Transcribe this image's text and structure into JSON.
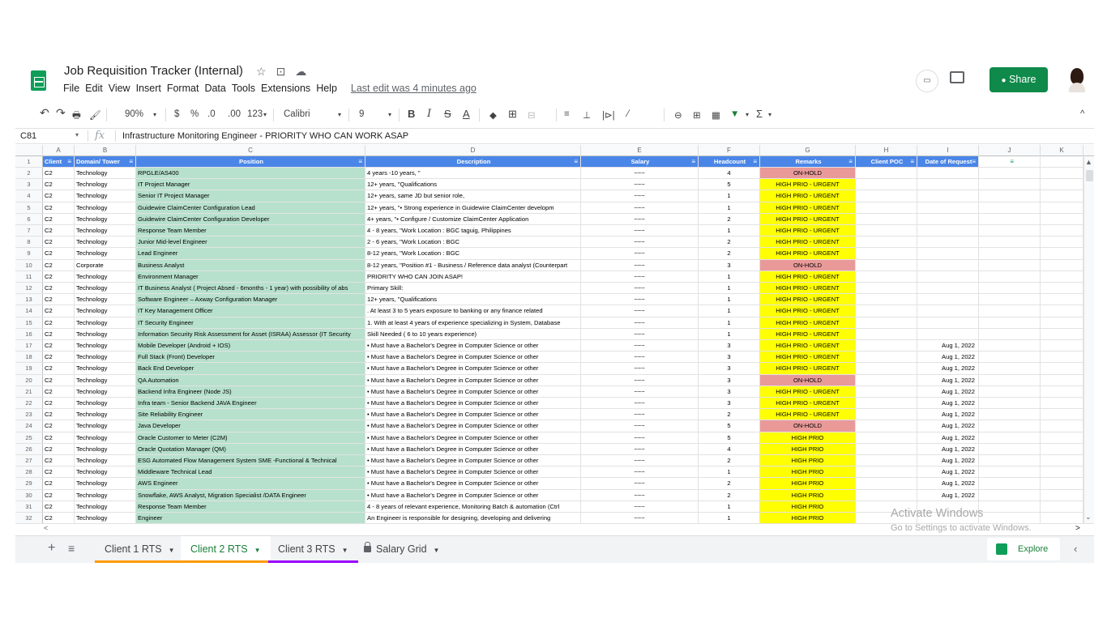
{
  "doc": {
    "title": "Job Requisition Tracker (Internal)",
    "star_icon": "☆",
    "move_icon": "⊡",
    "cloud_icon": "☁",
    "last_edit": "Last edit was 4 minutes ago",
    "share_label": "Share",
    "share_icon": "👤"
  },
  "menu": [
    "File",
    "Edit",
    "View",
    "Insert",
    "Format",
    "Data",
    "Tools",
    "Extensions",
    "Help"
  ],
  "toolbar": {
    "undo": "↶",
    "redo": "↷",
    "print": "🖶",
    "paint": "🖌",
    "zoom": "90%",
    "dropdown": "▾",
    "currency": "$",
    "percent": "%",
    "dec_less": ".0",
    "dec_more": ".00",
    "more_formats": "123",
    "font": "Calibri",
    "size": "9",
    "bold": "B",
    "italic": "I",
    "strike": "S",
    "textcolor": "A",
    "fill": "◆",
    "borders": "⊞",
    "merge": "⊟",
    "halign": "≡",
    "valign": "⊥",
    "wrap": "|⊳|",
    "rotate": "⁄",
    "link": "⊖",
    "comment": "⊞",
    "chart": "▦",
    "filter": "▼",
    "functions": "Σ",
    "collapse": "^"
  },
  "formula": {
    "cell_ref": "C81",
    "fx": "fx",
    "content": "Infrastructure Monitoring Engineer  - PRIORITY WHO CAN WORK ASAP"
  },
  "columns": [
    "A",
    "B",
    "C",
    "D",
    "E",
    "F",
    "G",
    "H",
    "I",
    "J",
    "K"
  ],
  "header": {
    "client": "Client",
    "domain": "Domain/ Tower",
    "position": "Position",
    "description": "Description",
    "salary": "Salary",
    "headcount": "Headcount",
    "remarks": "Remarks",
    "client_poc": "Client POC",
    "date": "Date of Request",
    "filter_icon": "≡"
  },
  "rows": [
    {
      "n": "2",
      "client": "C2",
      "domain": "Technology",
      "position": "RPGLE/AS400",
      "description": "4 years -10 years, \"",
      "salary": "~~~",
      "headcount": "4",
      "remarks": "ON-HOLD",
      "status": "hold",
      "date": ""
    },
    {
      "n": "3",
      "client": "C2",
      "domain": "Technology",
      "position": "IT Project Manager",
      "description": "12+ years, \"Qualifications",
      "salary": "~~~",
      "headcount": "5",
      "remarks": "HIGH PRIO - URGENT",
      "status": "urgent",
      "date": ""
    },
    {
      "n": "4",
      "client": "C2",
      "domain": "Technology",
      "position": "Senior IT Project Manager",
      "description": "12+ years, same JD but senior role,",
      "salary": "~~~",
      "headcount": "1",
      "remarks": "HIGH PRIO - URGENT",
      "status": "urgent",
      "date": ""
    },
    {
      "n": "5",
      "client": "C2",
      "domain": "Technology",
      "position": "Guidewire ClaimCenter Configuration Lead",
      "description": "12+ years, \"•       Strong experience in Guidewire ClaimCenter developm",
      "salary": "~~~",
      "headcount": "1",
      "remarks": "HIGH PRIO - URGENT",
      "status": "urgent",
      "date": ""
    },
    {
      "n": "6",
      "client": "C2",
      "domain": "Technology",
      "position": "Guidewire ClaimCenter Configuration Developer",
      "description": "4+ years, \"•       Configure / Customize ClaimCenter Application",
      "salary": "~~~",
      "headcount": "2",
      "remarks": "HIGH PRIO - URGENT",
      "status": "urgent",
      "date": ""
    },
    {
      "n": "7",
      "client": "C2",
      "domain": "Technology",
      "position": "Response Team Member",
      "description": "4 - 8 years, \"Work Location :  BGC taguig, Philippines",
      "salary": "~~~",
      "headcount": "1",
      "remarks": "HIGH PRIO - URGENT",
      "status": "urgent",
      "date": ""
    },
    {
      "n": "8",
      "client": "C2",
      "domain": "Technology",
      "position": "Junior Mid-level Engineer",
      "description": "2 - 6 years, \"Work Location : BGC",
      "salary": "~~~",
      "headcount": "2",
      "remarks": "HIGH PRIO - URGENT",
      "status": "urgent",
      "date": ""
    },
    {
      "n": "9",
      "client": "C2",
      "domain": "Technology",
      "position": "Lead Engineer",
      "description": "8-12 years, \"Work Location : BGC",
      "salary": "~~~",
      "headcount": "2",
      "remarks": "HIGH PRIO - URGENT",
      "status": "urgent",
      "date": ""
    },
    {
      "n": "10",
      "client": "C2",
      "domain": "Corporate",
      "position": "Business Analyst",
      "description": "8-12 years, \"Position #1 - Business / Reference data analyst (Counterpart",
      "salary": "~~~",
      "headcount": "3",
      "remarks": "ON-HOLD",
      "status": "hold",
      "date": ""
    },
    {
      "n": "11",
      "client": "C2",
      "domain": "Technology",
      "position": "Environment Manager",
      "description": "PRIORITY WHO CAN JOIN ASAP!",
      "salary": "~~~",
      "headcount": "1",
      "remarks": "HIGH PRIO - URGENT",
      "status": "urgent",
      "date": ""
    },
    {
      "n": "12",
      "client": "C2",
      "domain": "Technology",
      "position": "IT Business Analyst ( Project Absed - 6months - 1 year) with possibility of abs",
      "description": "Primary Skill:",
      "salary": "~~~",
      "headcount": "1",
      "remarks": "HIGH PRIO - URGENT",
      "status": "urgent",
      "date": ""
    },
    {
      "n": "13",
      "client": "C2",
      "domain": "Technology",
      "position": "Software Engineer – Axway Configuration Manager",
      "description": "12+ years, \"Qualifications",
      "salary": "~~~",
      "headcount": "1",
      "remarks": "HIGH PRIO - URGENT",
      "status": "urgent",
      "date": ""
    },
    {
      "n": "14",
      "client": "C2",
      "domain": "Technology",
      "position": "IT Key Management Officer",
      "description": ". At least 3 to 5 years exposure to banking or any finance related",
      "salary": "~~~",
      "headcount": "1",
      "remarks": "HIGH PRIO - URGENT",
      "status": "urgent",
      "date": ""
    },
    {
      "n": "15",
      "client": "C2",
      "domain": "Technology",
      "position": "IT Security Engineer",
      "description": "1. With at least 4 years of experience specializing in System, Database",
      "salary": "~~~",
      "headcount": "1",
      "remarks": "HIGH PRIO - URGENT",
      "status": "urgent",
      "date": ""
    },
    {
      "n": "16",
      "client": "C2",
      "domain": "Technology",
      "position": " Information Security Risk Assessment for Asset (ISRAA) Assessor (IT Security",
      "description": "Skill Needed ( 6 to 10 years experience)",
      "salary": "~~~",
      "headcount": "1",
      "remarks": "HIGH PRIO - URGENT",
      "status": "urgent",
      "date": ""
    },
    {
      "n": "17",
      "client": "C2",
      "domain": "Technology",
      "position": "Mobile Developer (Android + IOS)",
      "description": "•       Must have a Bachelor's Degree in Computer Science or other",
      "salary": "~~~",
      "headcount": "3",
      "remarks": "HIGH PRIO - URGENT",
      "status": "urgent",
      "date": "Aug 1, 2022"
    },
    {
      "n": "18",
      "client": "C2",
      "domain": "Technology",
      "position": "Full Stack (Front) Developer",
      "description": "•       Must have a Bachelor's Degree in Computer Science or other",
      "salary": "~~~",
      "headcount": "3",
      "remarks": "HIGH PRIO - URGENT",
      "status": "urgent",
      "date": "Aug 1, 2022"
    },
    {
      "n": "19",
      "client": "C2",
      "domain": "Technology",
      "position": "Back End Developer",
      "description": "•       Must have a Bachelor's Degree in Computer Science or other",
      "salary": "~~~",
      "headcount": "3",
      "remarks": "HIGH PRIO - URGENT",
      "status": "urgent",
      "date": "Aug 1, 2022"
    },
    {
      "n": "20",
      "client": "C2",
      "domain": "Technology",
      "position": "QA Automation",
      "description": "•       Must have a Bachelor's Degree in Computer Science or other",
      "salary": "~~~",
      "headcount": "3",
      "remarks": "ON-HOLD",
      "status": "hold",
      "date": "Aug 1, 2022"
    },
    {
      "n": "21",
      "client": "C2",
      "domain": "Technology",
      "position": "Backend Infra Engineer (Node JS)",
      "description": "•       Must have a Bachelor's Degree in Computer Science or other",
      "salary": "~~~",
      "headcount": "3",
      "remarks": "HIGH PRIO - URGENT",
      "status": "urgent",
      "date": "Aug 1, 2022"
    },
    {
      "n": "22",
      "client": "C2",
      "domain": "Technology",
      "position": "Infra team - Senior Backend JAVA Engineer",
      "description": "•       Must have a Bachelor's Degree in Computer Science or other",
      "salary": "~~~",
      "headcount": "3",
      "remarks": "HIGH PRIO - URGENT",
      "status": "urgent",
      "date": "Aug 1, 2022"
    },
    {
      "n": "23",
      "client": "C2",
      "domain": "Technology",
      "position": "Site Reliability Engineer",
      "description": "•       Must have a Bachelor's Degree in Computer Science or other",
      "salary": "~~~",
      "headcount": "2",
      "remarks": "HIGH PRIO - URGENT",
      "status": "urgent",
      "date": "Aug 1, 2022"
    },
    {
      "n": "24",
      "client": "C2",
      "domain": "Technology",
      "position": "Java Developer",
      "description": "•       Must have a Bachelor's Degree in Computer Science or other",
      "salary": "~~~",
      "headcount": "5",
      "remarks": "ON-HOLD",
      "status": "hold",
      "date": "Aug 1, 2022"
    },
    {
      "n": "25",
      "client": "C2",
      "domain": "Technology",
      "position": "Oracle Customer to Meter (C2M)",
      "description": "•       Must have a Bachelor's Degree in Computer Science or other",
      "salary": "~~~",
      "headcount": "5",
      "remarks": "HIGH PRIO",
      "status": "urgent",
      "date": "Aug 1, 2022"
    },
    {
      "n": "26",
      "client": "C2",
      "domain": "Technology",
      "position": "Oracle Quotation Manager (QM)",
      "description": "•       Must have a Bachelor's Degree in Computer Science or other",
      "salary": "~~~",
      "headcount": "4",
      "remarks": "HIGH PRIO",
      "status": "urgent",
      "date": "Aug 1, 2022"
    },
    {
      "n": "27",
      "client": "C2",
      "domain": "Technology",
      "position": "ESG Automated Flow Management System SME -Functional & Technical",
      "description": "•       Must have a Bachelor's Degree in Computer Science or other",
      "salary": "~~~",
      "headcount": "2",
      "remarks": "HIGH PRIO",
      "status": "urgent",
      "date": "Aug 1, 2022"
    },
    {
      "n": "28",
      "client": "C2",
      "domain": "Technology",
      "position": "Middleware Technical Lead",
      "description": "•       Must have a Bachelor's Degree in Computer Science or other",
      "salary": "~~~",
      "headcount": "1",
      "remarks": "HIGH PRIO",
      "status": "urgent",
      "date": "Aug 1, 2022"
    },
    {
      "n": "29",
      "client": "C2",
      "domain": "Technology",
      "position": "AWS Engineer",
      "description": "•       Must have a Bachelor's Degree in Computer Science or other",
      "salary": "~~~",
      "headcount": "2",
      "remarks": "HIGH PRIO",
      "status": "urgent",
      "date": "Aug 1, 2022"
    },
    {
      "n": "30",
      "client": "C2",
      "domain": "Technology",
      "position": "Snowflake, AWS Analyst, Migration Specialist /DATA Engineer",
      "description": "•       Must have a Bachelor's Degree in Computer Science or other",
      "salary": "~~~",
      "headcount": "2",
      "remarks": "HIGH PRIO",
      "status": "urgent",
      "date": "Aug 1, 2022"
    },
    {
      "n": "31",
      "client": "C2",
      "domain": "Technology",
      "position": "Response Team Member",
      "description": "4 - 8 years of relevant experience, Monitoring Batch & automation (Ctrl",
      "salary": "~~~",
      "headcount": "1",
      "remarks": "HIGH PRIO",
      "status": "urgent",
      "date": ""
    },
    {
      "n": "32",
      "client": "C2",
      "domain": "Technology",
      "position": "Engineer",
      "description": "An Engineer is responsible for designing, developing and delivering",
      "salary": "~~~",
      "headcount": "1",
      "remarks": "HIGH PRIO",
      "status": "urgent",
      "date": ""
    }
  ],
  "watermark": {
    "line1": "Activate Windows",
    "line2": "Go to Settings to activate Windows."
  },
  "tabs": {
    "add": "+",
    "list": "≡",
    "items": [
      {
        "label": "Client 1 RTS",
        "arrow": "▼"
      },
      {
        "label": "Client 2 RTS",
        "arrow": "▼"
      },
      {
        "label": "Client 3 RTS",
        "arrow": "▼"
      },
      {
        "label": "Salary Grid",
        "arrow": "▼"
      }
    ],
    "explore": "Explore",
    "collapse": "‹"
  },
  "scroll": {
    "up": "▲",
    "down": "⌄",
    "left": "<",
    "right": ">"
  },
  "colors": {
    "header_blue": "#4a86e8",
    "position_green": "#b7e1cd",
    "hold_red": "#ea9999",
    "urgent_yellow": "#ffff00",
    "share_green": "#0f8a4a"
  }
}
